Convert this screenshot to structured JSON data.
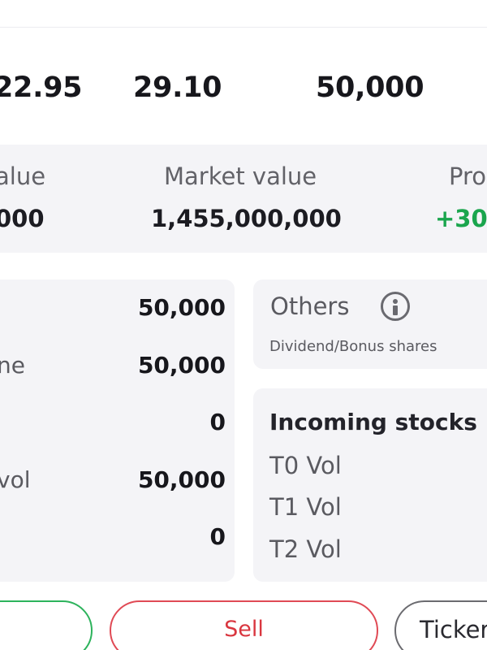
{
  "prices": {
    "value_1": "22.95",
    "value_2": "29.10",
    "value_3": "50,000"
  },
  "valuation": {
    "cost_value_label": "alue",
    "cost_value": "000",
    "market_value_label": "Market value",
    "market_value": "1,455,000,000",
    "profit_label": "Pro",
    "profit_value": "+30"
  },
  "holdings": {
    "rows": [
      {
        "label": "",
        "value": "50,000"
      },
      {
        "label": "ne",
        "value": "50,000"
      },
      {
        "label": "",
        "value": "0"
      },
      {
        "label": "vol",
        "value": "50,000"
      },
      {
        "label": "",
        "value": "0"
      }
    ]
  },
  "others": {
    "title": "Others",
    "subtitle": "Dividend/Bonus shares",
    "icon": "info-icon"
  },
  "incoming": {
    "title": "Incoming stocks",
    "t0_label": "T0 Vol",
    "t1_label": "T1 Vol",
    "t2_label": "T2 Vol"
  },
  "actions": {
    "buy_label": "",
    "sell_label": "Sell",
    "ticker_label": "Ticker"
  },
  "colors": {
    "positive": "#1aa54d",
    "sell": "#d9363f",
    "buy_border": "#2db35c",
    "card_bg": "#f4f4f7"
  }
}
